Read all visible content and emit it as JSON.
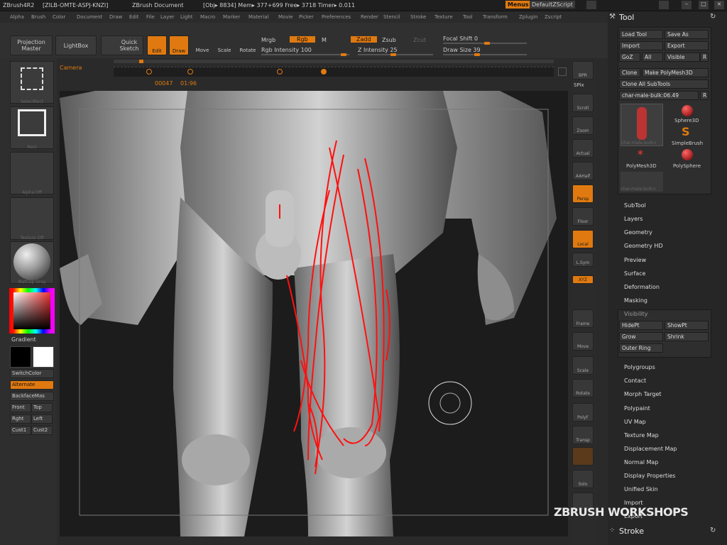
{
  "titlebar": {
    "app": "ZBrush4R2",
    "serial": "[ZILB-OMTE-ASPJ-KNZI]",
    "document": "ZBrush Document",
    "stats": "[Obj▸ 8834] Mem▸ 377+699 Free▸ 3718 Timer▸ 0.011",
    "menus_btn": "Menus",
    "script_btn": "DefaultZScript"
  },
  "menubar": [
    "Alpha",
    "Brush",
    "Color",
    "Document",
    "Draw",
    "Edit",
    "File",
    "Layer",
    "Light",
    "Macro",
    "Marker",
    "Material",
    "Movie",
    "Picker",
    "Preferences",
    "Render",
    "Stencil",
    "Stroke",
    "Texture",
    "Tool",
    "Transform",
    "Zplugin",
    "Zscript"
  ],
  "shelf": {
    "projection_master": "Projection Master",
    "lightbox": "LightBox",
    "quick_sketch": "Quick Sketch",
    "edit": "Edit",
    "draw": "Draw",
    "move": "Move",
    "scale": "Scale",
    "rotate": "Rotate",
    "mrgb": "Mrgb",
    "rgb": "Rgb",
    "m": "M",
    "rgb_intensity": "Rgb Intensity 100",
    "zadd": "Zadd",
    "zsub": "Zsub",
    "zcut": "Zcut",
    "z_intensity": "Z Intensity 25",
    "focal_shift": "Focal Shift 0",
    "draw_size": "Draw Size 39"
  },
  "left": {
    "brush_label": "SelectRect",
    "stroke_label": "Rect",
    "alpha_label": "Alpha Off",
    "texture_label": "Texture Off",
    "material_label": "MatCap Gray",
    "gradient": "Gradient",
    "switchcolor": "SwitchColor",
    "alternate": "Alternate",
    "backfacemask": "BackfaceMas",
    "front": "Front",
    "top": "Top",
    "right": "Rght",
    "leftb": "Left",
    "cust1": "Cust1",
    "cust2": "Cust2"
  },
  "timeline": {
    "camera": "Camera",
    "frame": "00047",
    "total": "01:96"
  },
  "right_icons": [
    "BPR",
    "SPix",
    "Scroll",
    "Zoom",
    "Actual",
    "AAHalf",
    "Persp",
    "Floor",
    "Local",
    "L.Sym",
    "XYZ",
    "Frame",
    "Move",
    "Scale",
    "Rotate",
    "PolyF",
    "Transp",
    "Ghost",
    "Solo",
    "Xpose"
  ],
  "tool": {
    "title": "Tool",
    "load_tool": "Load Tool",
    "save_as": "Save As",
    "import": "Import",
    "export": "Export",
    "goz": "GoZ",
    "all": "All",
    "visible": "Visible",
    "r": "R",
    "clone": "Clone",
    "make_polymesh": "Make PolyMesh3D",
    "clone_all": "Clone All SubTools",
    "current_tool": "char-male-bulk:06.49",
    "thumbs": [
      "char-male-bulk<",
      "Sphere3D",
      "SimpleBrush",
      "PolyMesh3D",
      "PolySphere",
      "char-male-bulk<"
    ],
    "sections": [
      "SubTool",
      "Layers",
      "Geometry",
      "Geometry HD",
      "Preview",
      "Surface",
      "Deformation",
      "Masking"
    ],
    "visibility": "Visibility",
    "hidept": "HidePt",
    "showpt": "ShowPt",
    "grow": "Grow",
    "shrink": "Shrink",
    "outer_ring": "Outer Ring",
    "sections2": [
      "Polygroups",
      "Contact",
      "Morph Target",
      "Polypaint",
      "UV Map",
      "Texture Map",
      "Displacement Map",
      "Normal Map",
      "Display Properties",
      "Unified Skin",
      "Import",
      "Export"
    ],
    "stroke": "Stroke"
  },
  "watermark": "ZBRUSH WORKSHOPS"
}
